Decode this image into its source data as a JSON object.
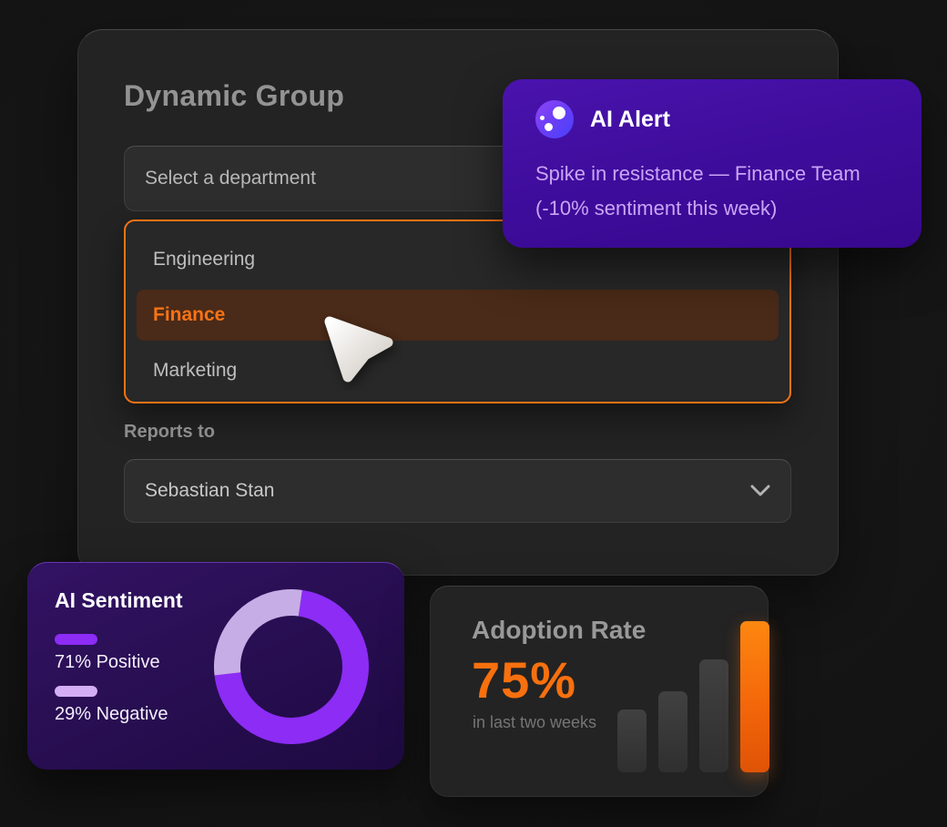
{
  "panel": {
    "title": "Dynamic Group"
  },
  "department_field": {
    "placeholder": "Select a department"
  },
  "department_dropdown": {
    "accent_color": "#f97316",
    "options": [
      {
        "label": "Engineering",
        "highlighted": false
      },
      {
        "label": "Finance",
        "highlighted": true
      },
      {
        "label": "Marketing",
        "highlighted": false
      }
    ]
  },
  "reports_to": {
    "label": "Reports to",
    "value": "Sebastian Stan",
    "chevron_icon": "chevron-down-icon"
  },
  "ai_alert": {
    "icon": "ai-sparkle-icon",
    "title": "AI Alert",
    "message": "Spike in resistance — Finance Team (-10% sentiment this week)",
    "background_top": "#4a13ad",
    "background_bottom": "#37088d",
    "message_color": "#c9a5f6"
  },
  "ai_sentiment": {
    "title": "AI Sentiment",
    "legend": [
      {
        "swatch_color": "#8c2cf5",
        "label": "71% Positive"
      },
      {
        "swatch_color": "#d4aef5",
        "label": "29% Negative"
      }
    ]
  },
  "adoption": {
    "title": "Adoption Rate",
    "value": "75%",
    "subtitle": "in last two weeks",
    "accent_color": "#f8700e"
  },
  "chart_data": [
    {
      "type": "pie",
      "donut": true,
      "title": "AI Sentiment",
      "labels": [
        "Positive",
        "Negative"
      ],
      "values": [
        71,
        29
      ],
      "colors": [
        "#8c2cf5",
        "#c7ade6"
      ],
      "start_angle_deg": 8,
      "legend_position": "left"
    },
    {
      "type": "bar",
      "title": "Adoption Rate",
      "values": [
        31,
        40,
        56,
        75
      ],
      "ylim": [
        0,
        100
      ],
      "highlight_index": 3,
      "bar_color": "#3a3a3a",
      "highlight_color": "#f8700e"
    }
  ]
}
